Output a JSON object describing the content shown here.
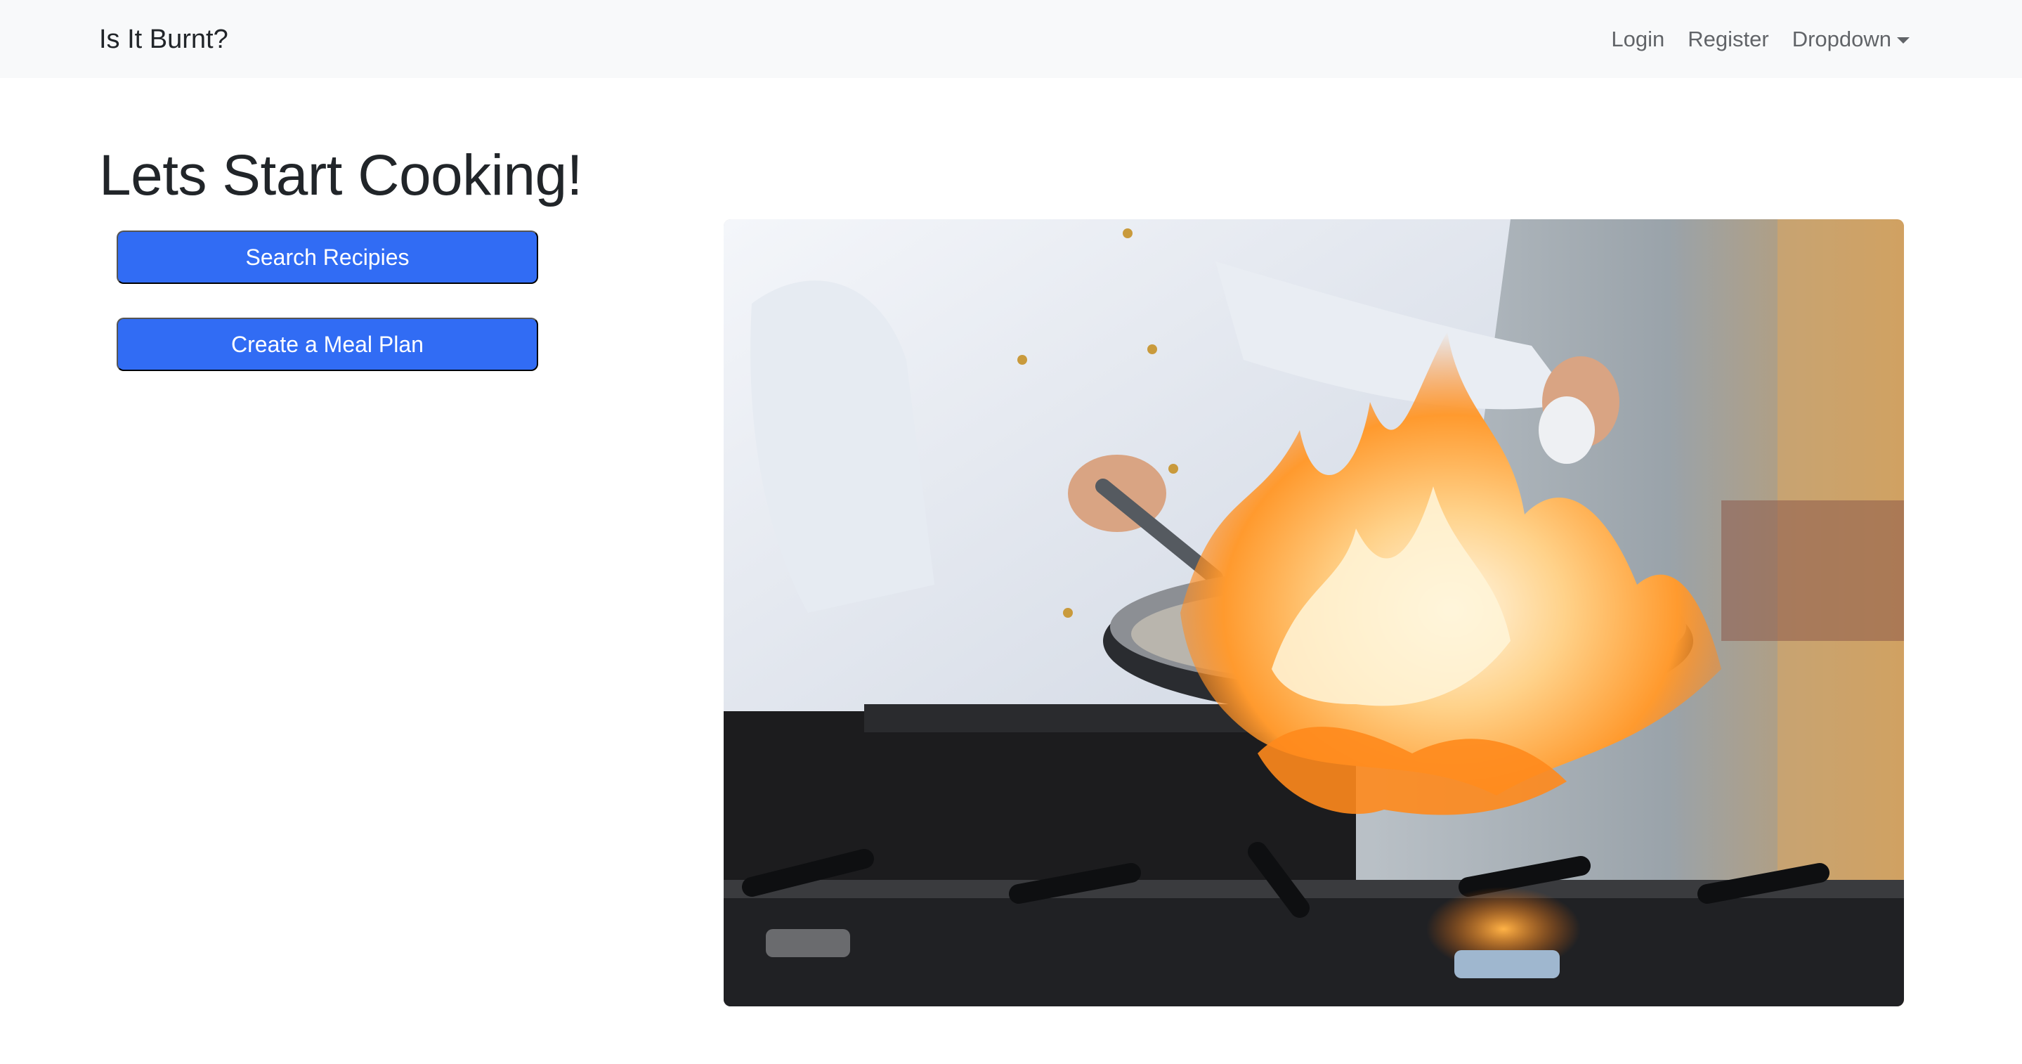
{
  "navbar": {
    "brand": "Is It Burnt?",
    "links": [
      {
        "label": "Login"
      },
      {
        "label": "Register"
      },
      {
        "label": "Dropdown",
        "icon": "caret-down-icon"
      }
    ]
  },
  "main": {
    "title": "Lets Start Cooking!",
    "buttons": [
      {
        "label": "Search Recipies"
      },
      {
        "label": "Create a Meal Plan"
      }
    ]
  },
  "colors": {
    "navbar_bg": "#f8f9fa",
    "button_primary": "#316cf4"
  }
}
